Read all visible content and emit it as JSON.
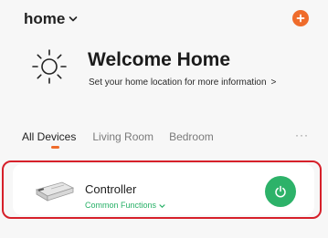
{
  "header": {
    "home_label": "home",
    "accent_color": "#ef6c2b",
    "add_icon": "plus-icon"
  },
  "welcome": {
    "title": "Welcome Home",
    "subtitle": "Set your home location for more information",
    "subtitle_arrow": ">",
    "icon": "sun-icon"
  },
  "tabs": {
    "items": [
      {
        "label": "All Devices",
        "active": true
      },
      {
        "label": "Living Room",
        "active": false
      },
      {
        "label": "Bedroom",
        "active": false
      }
    ],
    "more_label": "···"
  },
  "device": {
    "name": "Controller",
    "functions_label": "Common Functions",
    "power_icon": "power-icon",
    "power_color": "#2db269",
    "functions_color": "#26b066"
  },
  "annotation": {
    "highlight_color": "#d6202a"
  }
}
